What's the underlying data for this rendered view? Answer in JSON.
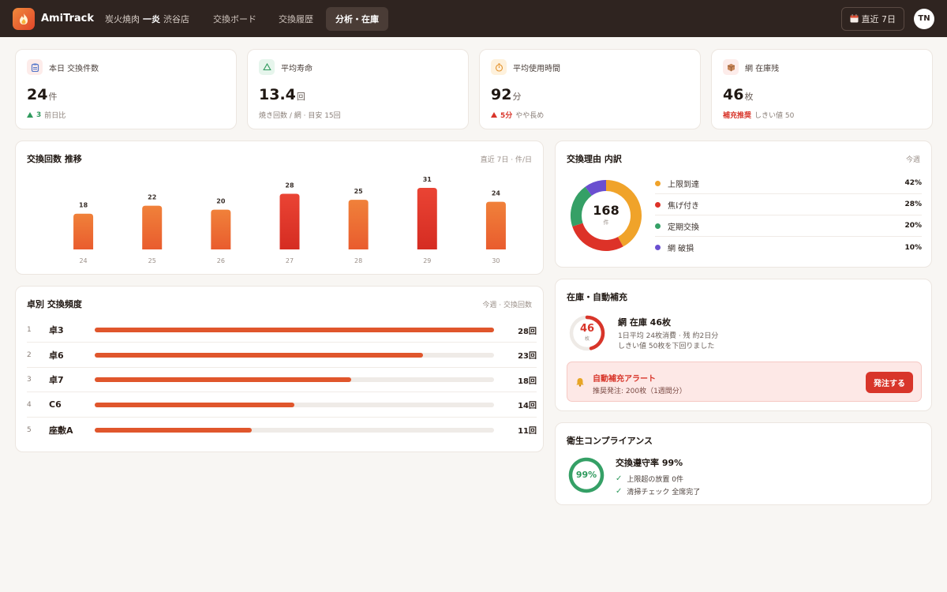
{
  "header": {
    "brand": "AmiTrack",
    "store_prefix": "炭火焼肉",
    "store_name": "一炎",
    "store_branch": "渋谷店",
    "tabs": [
      {
        "label": "交換ボード",
        "active": false
      },
      {
        "label": "交換履歴",
        "active": false
      },
      {
        "label": "分析・在庫",
        "active": true
      }
    ],
    "range_label": "直近 7日",
    "user_initials": "TN"
  },
  "kpis": [
    {
      "label": "本日 交換件数",
      "value": "24",
      "unit": "件",
      "note_strong": "3",
      "note": "前日比",
      "icon": "clipboard-icon",
      "trend": "up-green"
    },
    {
      "label": "平均寿命",
      "value": "13.4",
      "unit": "回",
      "note_strong": "",
      "note": "焼き回数 / 網 · 目安 15回",
      "icon": "recycle-icon",
      "trend": "none"
    },
    {
      "label": "平均使用時間",
      "value": "92",
      "unit": "分",
      "note_strong": "5分",
      "note": "やや長め",
      "icon": "timer-icon",
      "trend": "up-red"
    },
    {
      "label": "網 在庫残",
      "value": "46",
      "unit": "枚",
      "note_strong": "補充推奨",
      "note": "しきい値 50",
      "icon": "box-icon",
      "trend": "warn"
    }
  ],
  "trend_card": {
    "title": "交換回数 推移",
    "meta": "直近 7日 · 件/日"
  },
  "chart_data": {
    "type": "bar",
    "categories": [
      "24",
      "25",
      "26",
      "27",
      "28",
      "29",
      "30"
    ],
    "values": [
      18,
      22,
      20,
      28,
      25,
      31,
      24
    ],
    "highlighted": [
      false,
      false,
      false,
      true,
      false,
      true,
      false
    ],
    "ylim": [
      0,
      31
    ],
    "colors": {
      "normal": "#ef6f35",
      "high": "#dd3228"
    }
  },
  "freq_card": {
    "title": "卓別 交換頻度",
    "meta": "今週 · 交換回数",
    "rows": [
      {
        "rank": "1",
        "name": "卓3",
        "value": 28,
        "count": "28回"
      },
      {
        "rank": "2",
        "name": "卓6",
        "value": 23,
        "count": "23回"
      },
      {
        "rank": "3",
        "name": "卓7",
        "value": 18,
        "count": "18回"
      },
      {
        "rank": "4",
        "name": "C6",
        "value": 14,
        "count": "14回"
      },
      {
        "rank": "5",
        "name": "座敷A",
        "value": 11,
        "count": "11回"
      }
    ],
    "max": 28
  },
  "reason_card": {
    "title": "交換理由 内訳",
    "meta": "今週",
    "total": "168",
    "total_unit": "件",
    "items": [
      {
        "label": "上限到達",
        "pct": 42,
        "pct_label": "42%",
        "color": "#f0a32a"
      },
      {
        "label": "焦げ付き",
        "pct": 28,
        "pct_label": "28%",
        "color": "#dd3228"
      },
      {
        "label": "定期交換",
        "pct": 20,
        "pct_label": "20%",
        "color": "#35a066"
      },
      {
        "label": "網 破損",
        "pct": 10,
        "pct_label": "10%",
        "color": "#6a4fd0"
      }
    ]
  },
  "stock_card": {
    "title": "在庫・自動補充",
    "gauge_value": "46",
    "gauge_unit": "枚",
    "gauge_fraction": 0.46,
    "headline": "網 在庫 46枚",
    "line1": "1日平均 24枚消費 · 残 約2日分",
    "line2": "しきい値 50枚を下回りました",
    "alert_title": "自動補充アラート",
    "alert_text": "推奨発注: 200枚（1週間分）",
    "order_button": "発注する"
  },
  "hygiene_card": {
    "title": "衛生コンプライアンス",
    "rate_label": "99%",
    "rate_fraction": 0.99,
    "headline": "交換遵守率 99%",
    "checks": [
      "上限超の放置 0件",
      "清掃チェック 全席完了"
    ]
  }
}
